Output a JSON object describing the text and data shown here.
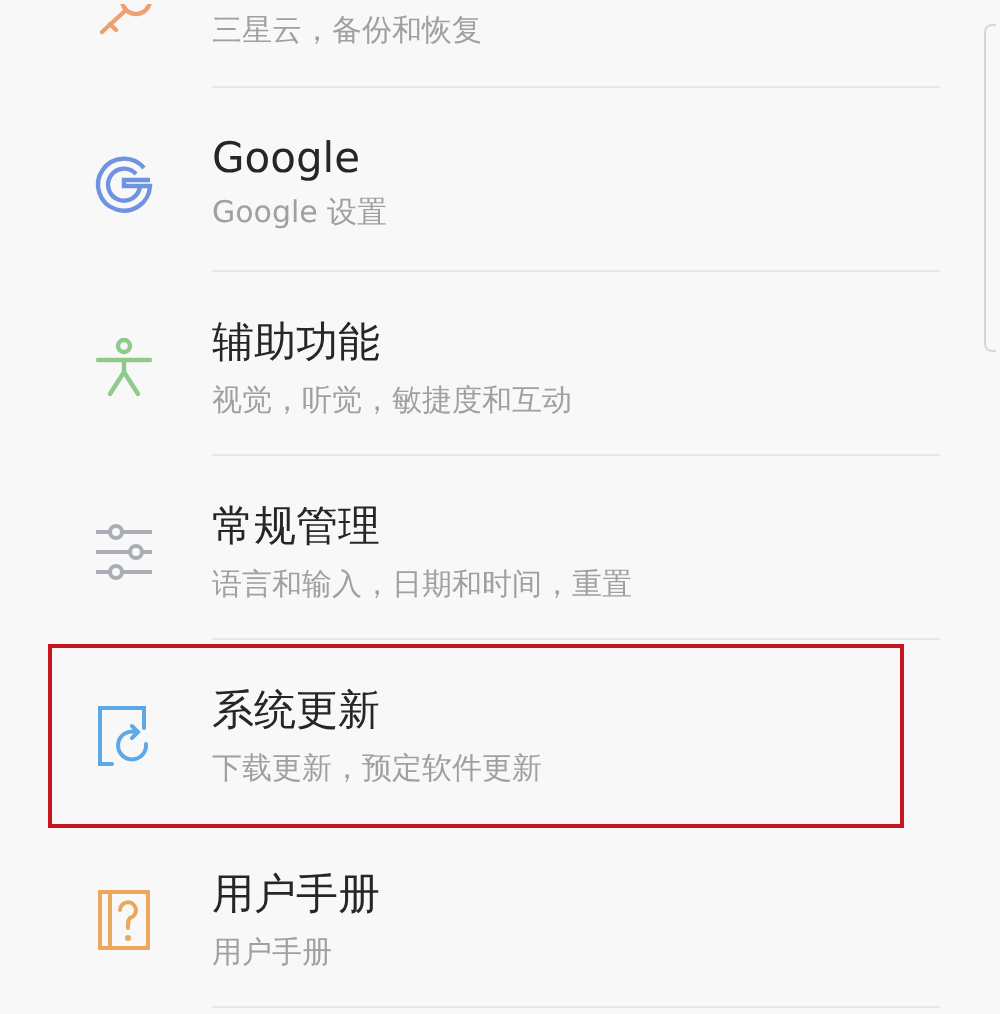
{
  "items": [
    {
      "kind": "key",
      "subtitle": "三星云，备份和恢复",
      "highlighted": false
    },
    {
      "kind": "google",
      "title": "Google",
      "subtitle": "Google 设置",
      "highlighted": false
    },
    {
      "kind": "accessibility",
      "title": "辅助功能",
      "subtitle": "视觉，听觉，敏捷度和互动",
      "highlighted": false
    },
    {
      "kind": "sliders",
      "title": "常规管理",
      "subtitle": "语言和输入，日期和时间，重置",
      "highlighted": false
    },
    {
      "kind": "update",
      "title": "系统更新",
      "subtitle": "下载更新，预定软件更新",
      "highlighted": true
    },
    {
      "kind": "manual",
      "title": "用户手册",
      "subtitle": "用户手册",
      "highlighted": false
    }
  ]
}
